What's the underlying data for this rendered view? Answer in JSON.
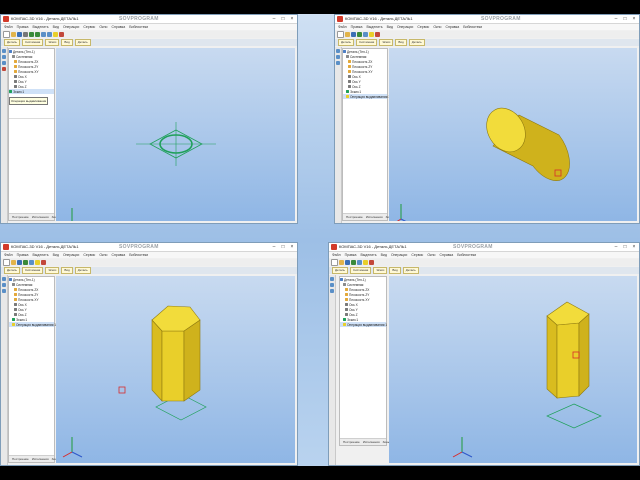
{
  "app": {
    "title": "КОМПАС-3D V16 - Деталь ДЕТАЛЬ1",
    "watermark": "SOVPROGRAM"
  },
  "menu": [
    "Файл",
    "Правка",
    "Выделить",
    "Вид",
    "Операции",
    "Сервис",
    "Окно",
    "Справка",
    "Библиотеки"
  ],
  "doc_tabs": [
    "Деталь",
    "Системная",
    "Эскиз",
    "Вид",
    "Деталь"
  ],
  "tree": {
    "items": [
      "Деталь (Тел-1)",
      "Системная",
      "Плоскость ZX",
      "Плоскость ZY",
      "Плоскость XY",
      "Ось X",
      "Ось Y",
      "Ось Z",
      "Эскиз:1",
      "Операция выдавливания:1"
    ],
    "tabs": [
      "Построение",
      "Исполнения",
      "Зоны"
    ]
  },
  "tooltip": "Операция выдавливания",
  "colors": {
    "solid_face": "#e9cf2a",
    "solid_top": "#f2dc3b",
    "solid_side": "#cfb21c",
    "sketch": "#1fa05a",
    "axis_red": "#d72b2b",
    "axis_green": "#1e9b3a",
    "axis_blue": "#2d57c9"
  }
}
